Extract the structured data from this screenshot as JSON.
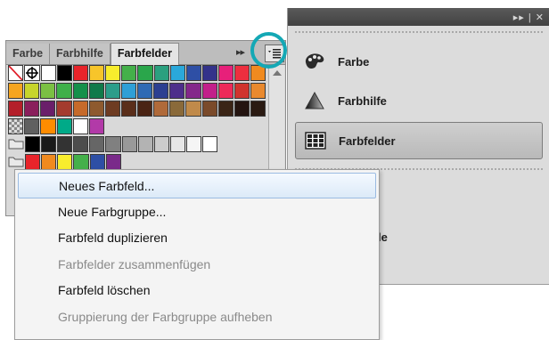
{
  "dock": {
    "items": [
      {
        "label": "Farbe",
        "icon": "palette-icon",
        "active": false
      },
      {
        "label": "Farbhilfe",
        "icon": "color-guide-icon",
        "active": false
      },
      {
        "label": "Farbfelder",
        "icon": "swatches-grid-icon",
        "active": true
      }
    ],
    "partial_label": "le"
  },
  "panel": {
    "tabs": [
      {
        "label": "Farbe",
        "active": false
      },
      {
        "label": "Farbhilfe",
        "active": false
      },
      {
        "label": "Farbfelder",
        "active": true
      }
    ],
    "overflow_glyph": "▸▸",
    "highlight_color": "#14a8b5"
  },
  "swatch_rows": [
    [
      "none",
      "reg",
      "#ffffff",
      "#000000",
      "#e8242a",
      "#f7c52a",
      "#f8ed2d",
      "#44b04a",
      "#2aa64b",
      "#2ba07f",
      "#2aa8da",
      "#2e4fa5",
      "#33328a",
      "#e7207a",
      "#ed2e3f",
      "#f08a1f"
    ],
    [
      "#f5a51f",
      "#c7d42c",
      "#7bc043",
      "#3fb04a",
      "#14904a",
      "#117a4a",
      "#2c9d8a",
      "#2f9fd6",
      "#2f6ab4",
      "#2c3f91",
      "#4d2e8b",
      "#84288a",
      "#c2208a",
      "#ee2a59",
      "#d0342e",
      "#e9892e"
    ],
    [
      "#b41f2a",
      "#8a1f5c",
      "#6a1f6a",
      "#a43b2e",
      "#c66a2a",
      "#8e5a2e",
      "#6e3c22",
      "#5a2e1a",
      "#4a2414",
      "#b06a3a",
      "#8a6a3a",
      "#c08a4a",
      "#7a4a2a",
      "#3a2416",
      "#241410",
      "#2a1a12"
    ],
    [
      "pattern",
      "#606060",
      "#ff8c00",
      "#00aa88",
      "#ffffff",
      "#b23aa8",
      "empty",
      "empty",
      "empty",
      "empty",
      "empty",
      "empty",
      "empty",
      "empty",
      "empty",
      "empty"
    ],
    [
      "folder",
      "#000000",
      "#1a1a1a",
      "#333333",
      "#4d4d4d",
      "#666666",
      "#808080",
      "#999999",
      "#b3b3b3",
      "#cccccc",
      "#e6e6e6",
      "#f5f5f5",
      "#ffffff",
      "empty",
      "empty",
      "empty"
    ],
    [
      "folder",
      "#e8242a",
      "#f08a1f",
      "#f8ed2d",
      "#44b04a",
      "#2e4fa5",
      "#7a2a8a",
      "empty",
      "empty",
      "empty",
      "empty",
      "empty",
      "empty",
      "empty",
      "empty",
      "empty"
    ]
  ],
  "menu": {
    "items": [
      {
        "label": "Neues Farbfeld...",
        "disabled": false,
        "hover": true
      },
      {
        "label": "Neue Farbgruppe...",
        "disabled": false,
        "hover": false
      },
      {
        "label": "Farbfeld duplizieren",
        "disabled": false,
        "hover": false
      },
      {
        "label": "Farbfelder zusammenfügen",
        "disabled": true,
        "hover": false
      },
      {
        "label": "Farbfeld löschen",
        "disabled": false,
        "hover": false
      },
      {
        "label": "Gruppierung der Farbgruppe aufheben",
        "disabled": true,
        "hover": false
      }
    ]
  }
}
